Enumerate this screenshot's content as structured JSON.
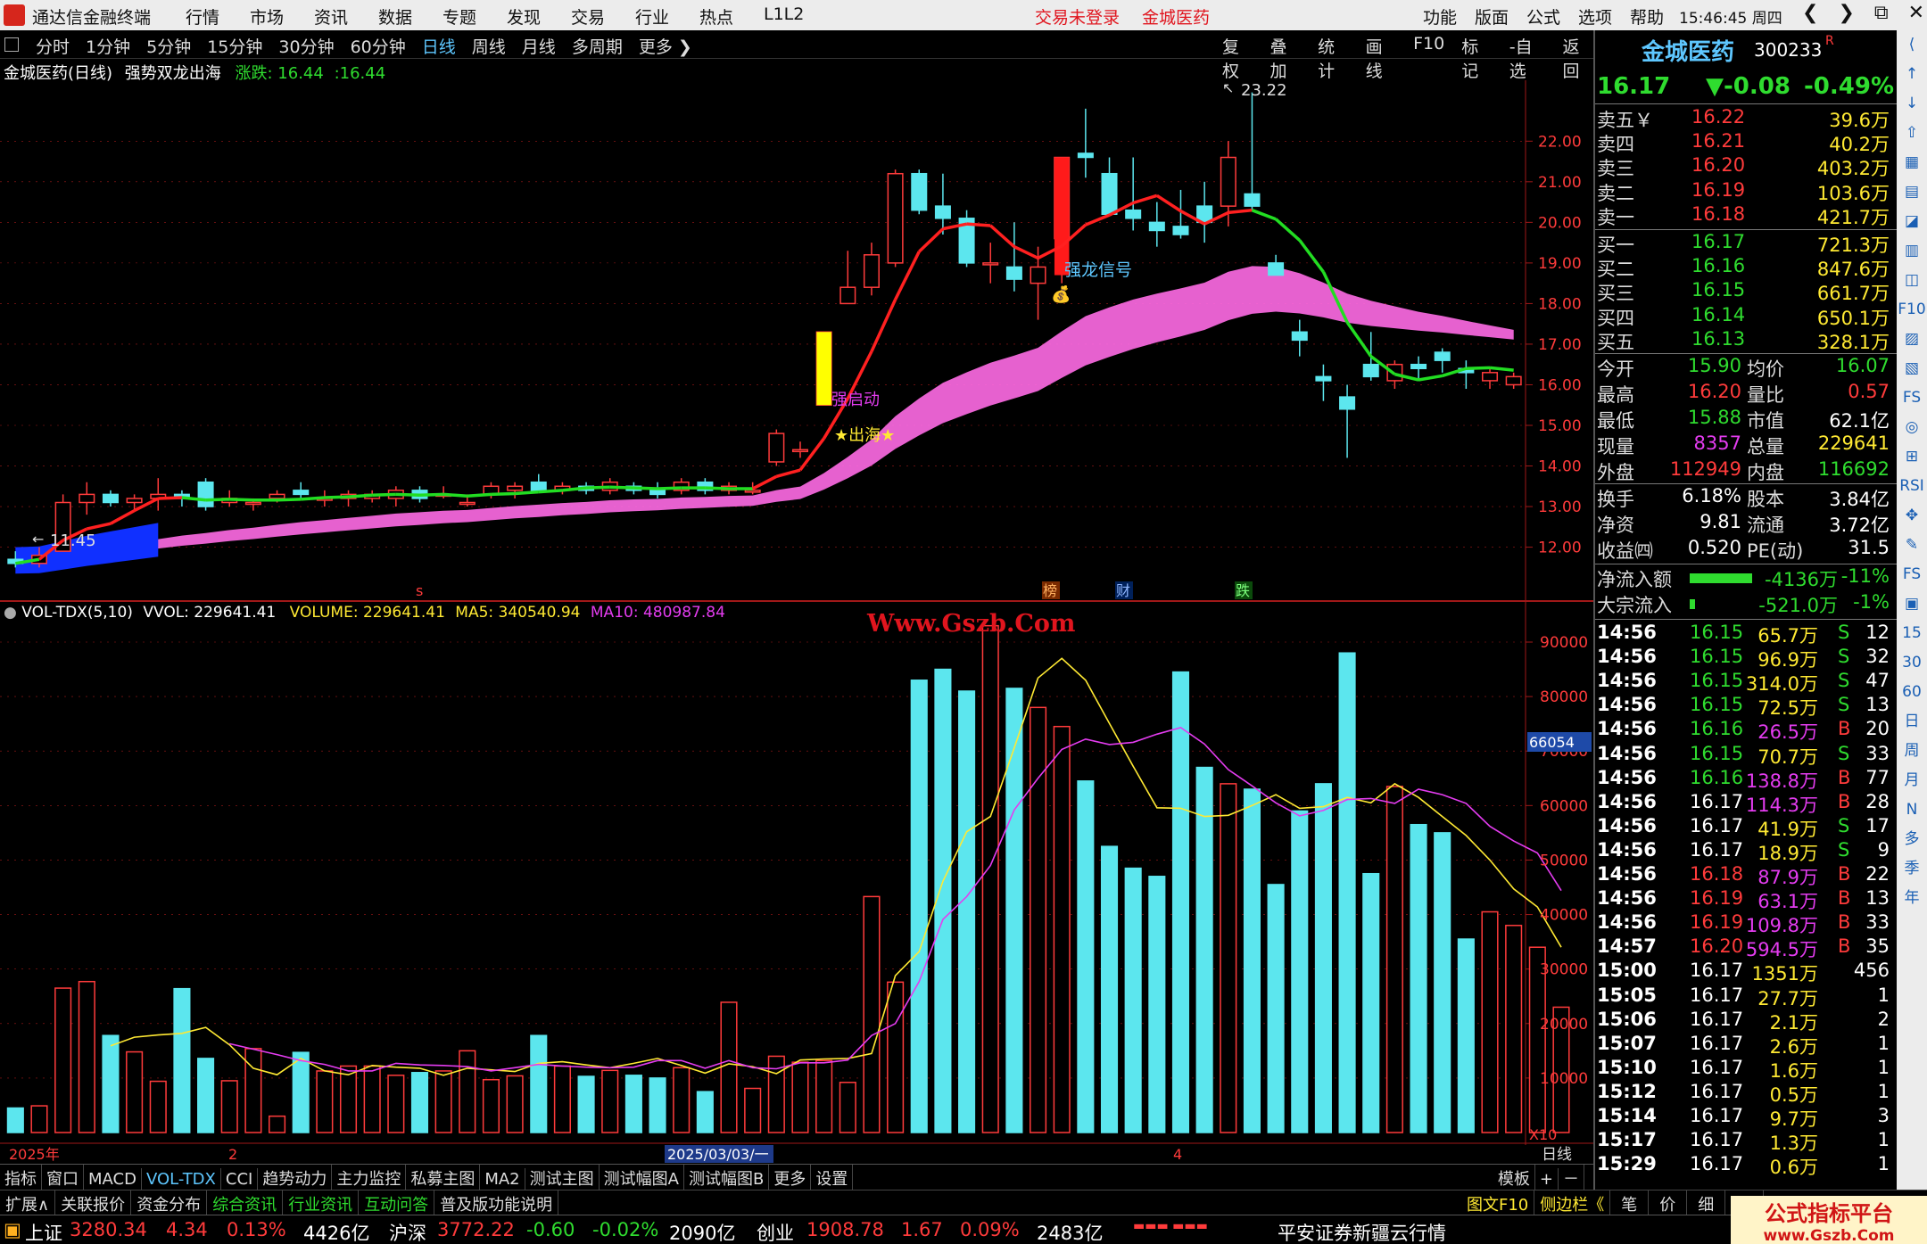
{
  "app": {
    "name": "通达信金融终端",
    "menu": [
      "行情",
      "市场",
      "资讯",
      "数据",
      "专题",
      "发现",
      "交易",
      "行业",
      "热点",
      "L1L2"
    ],
    "notice_login": "交易未登录",
    "notice_stock": "金城医药",
    "right_menu": [
      "功能",
      "版面",
      "公式",
      "选项",
      "帮助"
    ],
    "clock": "15:46:45",
    "weekday": "周四",
    "win_btns": [
      "❮",
      "❯",
      "⧉",
      "✕"
    ]
  },
  "periods": {
    "items": [
      "分时",
      "1分钟",
      "5分钟",
      "15分钟",
      "30分钟",
      "60分钟",
      "日线",
      "周线",
      "月线",
      "多周期",
      "更多 ❯"
    ],
    "active_index": 6,
    "tools": [
      "复权",
      "叠加",
      "统计",
      "画线",
      "F10",
      "标记",
      "-自选",
      "返回"
    ]
  },
  "chart_header": {
    "stock": "金城医药(日线)",
    "formula": "强势双龙出海",
    "change_label": "涨跌: 16.44",
    "change_value": ":16.44"
  },
  "chart_annotations": {
    "high_label": "23.22",
    "low_label": "11.45",
    "signal_dragon": "强龙信号",
    "signal_start": "强启动",
    "signal_sea": "★出海★",
    "marker_s": "s",
    "marker_bang": "榜",
    "marker_cai": "财",
    "marker_die": "跌",
    "y_ticks": [
      "22.00",
      "21.00",
      "20.00",
      "19.00",
      "18.00",
      "17.00",
      "16.00",
      "15.00",
      "14.00",
      "13.00",
      "12.00"
    ]
  },
  "volume_header": {
    "name": "VOL-TDX(5,10)",
    "vvol": "VVOL: 229641.41",
    "volume": "VOLUME: 229641.41",
    "ma5": "MA5: 340540.94",
    "ma10": "MA10: 480987.84",
    "y_ticks": [
      "90000",
      "80000",
      "70000",
      "60000",
      "50000",
      "40000",
      "30000",
      "20000",
      "10000"
    ],
    "cursor_value": "66054",
    "unit": "X10"
  },
  "watermark": "Www.Gszb.Com",
  "x_axis": {
    "labels": [
      "2025年",
      "2",
      "2025/03/03/一",
      "4"
    ],
    "period": "日线"
  },
  "bottom_tabs": {
    "items": [
      "指标",
      "窗口",
      "MACD",
      "VOL-TDX",
      "CCI",
      "趋势动力",
      "主力监控",
      "私募主图",
      "MA2",
      "测试主图",
      "测试幅图A",
      "测试幅图B",
      "更多",
      "设置"
    ],
    "active_index": 3,
    "right": [
      "模板",
      "+",
      "－"
    ]
  },
  "ext_bar": {
    "items": [
      "扩展∧",
      "关联报价",
      "资金分布",
      "综合资讯",
      "行业资讯",
      "互动问答",
      "普及版功能说明"
    ],
    "right": [
      "图文F10",
      "侧边栏《",
      "笔",
      "价",
      "细",
      "势"
    ]
  },
  "status": {
    "sh_label": "上证",
    "sh_value": "3280.34",
    "sh_change": "4.34",
    "sh_pct": "0.13%",
    "sh_amount": "4426亿",
    "hs_label": "沪深",
    "hs_value": "3772.22",
    "hs_change": "-0.60",
    "hs_pct": "-0.02%",
    "hs_amount": "2090亿",
    "cy_label": "创业",
    "cy_value": "1908.78",
    "cy_change": "1.67",
    "cy_pct": "0.09%",
    "cy_amount": "2483亿",
    "broker": "平安证券新疆云行情",
    "brand": "公式指标平台",
    "brand_url": "www.Gszb.Com"
  },
  "quote": {
    "name": "金城医药",
    "code": "300233",
    "flag": "R",
    "price": "16.17",
    "change": "▼-0.08",
    "pct": "-0.49%",
    "asks": [
      {
        "label": "卖五￥",
        "price": "16.22",
        "vol": "39.6万"
      },
      {
        "label": "卖四",
        "price": "16.21",
        "vol": "40.2万"
      },
      {
        "label": "卖三",
        "price": "16.20",
        "vol": "403.2万"
      },
      {
        "label": "卖二",
        "price": "16.19",
        "vol": "103.6万"
      },
      {
        "label": "卖一",
        "price": "16.18",
        "vol": "421.7万"
      }
    ],
    "bids": [
      {
        "label": "买一",
        "price": "16.17",
        "vol": "721.3万"
      },
      {
        "label": "买二",
        "price": "16.16",
        "vol": "847.6万"
      },
      {
        "label": "买三",
        "price": "16.15",
        "vol": "661.7万"
      },
      {
        "label": "买四",
        "price": "16.14",
        "vol": "650.1万"
      },
      {
        "label": "买五",
        "price": "16.13",
        "vol": "328.1万"
      }
    ],
    "stats": [
      {
        "l1": "今开",
        "v1": "15.90",
        "l2": "均价",
        "v2": "16.07"
      },
      {
        "l1": "最高",
        "v1": "16.20",
        "l2": "量比",
        "v2": "0.57"
      },
      {
        "l1": "最低",
        "v1": "15.88",
        "l2": "市值",
        "v2": "62.1亿"
      },
      {
        "l1": "现量",
        "v1": "8357",
        "l2": "总量",
        "v2": "229641"
      },
      {
        "l1": "外盘",
        "v1": "112949",
        "l2": "内盘",
        "v2": "116692"
      }
    ],
    "fund": [
      {
        "l1": "换手",
        "v1": "6.18%",
        "l2": "股本",
        "v2": "3.84亿"
      },
      {
        "l1": "净资",
        "v1": "9.81",
        "l2": "流通",
        "v2": "3.72亿"
      },
      {
        "l1": "收益㈣",
        "v1": "0.520",
        "l2": "PE(动)",
        "v2": "31.5"
      }
    ],
    "flows": [
      {
        "label": "净流入额",
        "value": "-4136万",
        "pct": "-11%",
        "bar": 0.7
      },
      {
        "label": "大宗流入",
        "value": "-521.0万",
        "pct": "-1%",
        "bar": 0.03
      }
    ],
    "ticks": [
      {
        "t": "14:56",
        "p": "16.15",
        "v": "65.7万",
        "s": "S",
        "n": "12"
      },
      {
        "t": "14:56",
        "p": "16.15",
        "v": "96.9万",
        "s": "S",
        "n": "32"
      },
      {
        "t": "14:56",
        "p": "16.15",
        "v": "314.0万",
        "s": "S",
        "n": "47"
      },
      {
        "t": "14:56",
        "p": "16.15",
        "v": "72.5万",
        "s": "S",
        "n": "13"
      },
      {
        "t": "14:56",
        "p": "16.16",
        "v": "26.5万",
        "s": "B",
        "n": "20"
      },
      {
        "t": "14:56",
        "p": "16.15",
        "v": "70.7万",
        "s": "S",
        "n": "33"
      },
      {
        "t": "14:56",
        "p": "16.16",
        "v": "138.8万",
        "s": "B",
        "n": "77"
      },
      {
        "t": "14:56",
        "p": "16.17",
        "v": "114.3万",
        "s": "B",
        "n": "28"
      },
      {
        "t": "14:56",
        "p": "16.17",
        "v": "41.9万",
        "s": "S",
        "n": "17"
      },
      {
        "t": "14:56",
        "p": "16.17",
        "v": "18.9万",
        "s": "S",
        "n": "9"
      },
      {
        "t": "14:56",
        "p": "16.18",
        "v": "87.9万",
        "s": "B",
        "n": "22"
      },
      {
        "t": "14:56",
        "p": "16.19",
        "v": "63.1万",
        "s": "B",
        "n": "13"
      },
      {
        "t": "14:56",
        "p": "16.19",
        "v": "109.8万",
        "s": "B",
        "n": "33"
      },
      {
        "t": "14:57",
        "p": "16.20",
        "v": "594.5万",
        "s": "B",
        "n": "35"
      },
      {
        "t": "15:00",
        "p": "16.17",
        "v": "1351万",
        "s": "",
        "n": "456"
      },
      {
        "t": "15:05",
        "p": "16.17",
        "v": "27.7万",
        "s": "",
        "n": "1"
      },
      {
        "t": "15:06",
        "p": "16.17",
        "v": "2.1万",
        "s": "",
        "n": "2"
      },
      {
        "t": "15:07",
        "p": "16.17",
        "v": "2.6万",
        "s": "",
        "n": "1"
      },
      {
        "t": "15:10",
        "p": "16.17",
        "v": "1.6万",
        "s": "",
        "n": "1"
      },
      {
        "t": "15:12",
        "p": "16.17",
        "v": "0.5万",
        "s": "",
        "n": "1"
      },
      {
        "t": "15:14",
        "p": "16.17",
        "v": "9.7万",
        "s": "",
        "n": "3"
      },
      {
        "t": "15:17",
        "p": "16.17",
        "v": "1.3万",
        "s": "",
        "n": "1"
      },
      {
        "t": "15:29",
        "p": "16.17",
        "v": "0.6万",
        "s": "",
        "n": "1"
      }
    ]
  },
  "side_toolbar": [
    "⟨",
    "↑",
    "↓",
    "⇧",
    "▦",
    "▤",
    "◪",
    "▥",
    "◫",
    "F10",
    "▨",
    "▧",
    "FS",
    "◎",
    "⊞",
    "RSI",
    "✥",
    "✎",
    "FS",
    "▣",
    "15",
    "30",
    "60",
    "日",
    "周",
    "月",
    "N",
    "多",
    "季",
    "年"
  ],
  "colors": {
    "up": "#ff3b3b",
    "down": "#5ce6ee",
    "ma_red": "#ff2020",
    "ma_green": "#22dd22",
    "band": "#ff6be6",
    "ma5_vol": "#ffe933",
    "ma10_vol": "#e43cf0"
  },
  "chart_data": [
    {
      "type": "candlestick",
      "title": "金城医药(日线)",
      "y_range": [
        11.2,
        23.5
      ],
      "candles": [
        [
          11.7,
          11.9,
          11.5,
          11.6
        ],
        [
          11.6,
          12.0,
          11.5,
          11.8
        ],
        [
          11.9,
          13.3,
          11.9,
          13.1
        ],
        [
          13.1,
          13.6,
          12.8,
          13.3
        ],
        [
          13.3,
          13.4,
          13.0,
          13.1
        ],
        [
          13.1,
          13.3,
          12.9,
          13.2
        ],
        [
          13.2,
          13.7,
          12.9,
          13.3
        ],
        [
          13.3,
          13.4,
          13.0,
          13.2
        ],
        [
          13.6,
          13.7,
          12.9,
          13.0
        ],
        [
          13.1,
          13.4,
          13.0,
          13.2
        ],
        [
          13.1,
          13.2,
          12.9,
          13.1
        ],
        [
          13.2,
          13.4,
          13.1,
          13.3
        ],
        [
          13.4,
          13.6,
          13.2,
          13.3
        ],
        [
          13.2,
          13.4,
          13.0,
          13.2
        ],
        [
          13.2,
          13.4,
          13.0,
          13.3
        ],
        [
          13.2,
          13.4,
          13.1,
          13.3
        ],
        [
          13.2,
          13.5,
          13.0,
          13.4
        ],
        [
          13.4,
          13.5,
          13.1,
          13.2
        ],
        [
          13.3,
          13.5,
          13.2,
          13.3
        ],
        [
          13.1,
          13.3,
          13.0,
          13.1
        ],
        [
          13.3,
          13.6,
          13.2,
          13.5
        ],
        [
          13.4,
          13.6,
          13.2,
          13.5
        ],
        [
          13.6,
          13.8,
          13.4,
          13.4
        ],
        [
          13.4,
          13.6,
          13.3,
          13.5
        ],
        [
          13.5,
          13.6,
          13.3,
          13.4
        ],
        [
          13.4,
          13.7,
          13.3,
          13.6
        ],
        [
          13.5,
          13.6,
          13.3,
          13.4
        ],
        [
          13.4,
          13.6,
          13.2,
          13.3
        ],
        [
          13.4,
          13.7,
          13.3,
          13.6
        ],
        [
          13.6,
          13.7,
          13.3,
          13.4
        ],
        [
          13.4,
          13.6,
          13.3,
          13.5
        ],
        [
          13.4,
          13.6,
          13.3,
          13.4
        ],
        [
          14.1,
          14.9,
          14.0,
          14.8
        ],
        [
          14.4,
          14.6,
          14.2,
          14.4
        ],
        [
          15.5,
          17.3,
          15.5,
          17.3
        ],
        [
          18.0,
          19.3,
          18.0,
          18.4
        ],
        [
          18.4,
          19.5,
          18.2,
          19.2
        ],
        [
          19.0,
          21.3,
          18.9,
          21.2
        ],
        [
          21.2,
          21.3,
          20.2,
          20.3
        ],
        [
          20.4,
          21.2,
          19.7,
          20.1
        ],
        [
          20.1,
          20.3,
          18.9,
          19.0
        ],
        [
          19.0,
          19.5,
          18.5,
          19.0
        ],
        [
          18.9,
          20.0,
          18.3,
          18.6
        ],
        [
          18.5,
          19.4,
          17.6,
          18.9
        ],
        [
          19.6,
          21.6,
          18.5,
          21.6
        ],
        [
          21.7,
          22.8,
          21.1,
          21.6
        ],
        [
          21.2,
          21.6,
          20.2,
          20.2
        ],
        [
          20.3,
          21.6,
          19.8,
          20.1
        ],
        [
          20.0,
          20.5,
          19.4,
          19.8
        ],
        [
          19.9,
          20.8,
          19.6,
          19.7
        ],
        [
          20.4,
          21.0,
          19.5,
          20.0
        ],
        [
          20.4,
          22.0,
          19.9,
          21.6
        ],
        [
          20.7,
          23.2,
          20.3,
          20.4
        ],
        [
          19.0,
          19.2,
          18.7,
          18.7
        ],
        [
          17.3,
          17.6,
          16.7,
          17.1
        ],
        [
          16.2,
          16.5,
          15.6,
          16.1
        ],
        [
          15.7,
          16.0,
          14.2,
          15.4
        ],
        [
          16.5,
          17.3,
          16.1,
          16.2
        ],
        [
          16.1,
          16.6,
          15.9,
          16.5
        ],
        [
          16.5,
          16.7,
          16.1,
          16.4
        ],
        [
          16.8,
          16.9,
          16.3,
          16.6
        ],
        [
          16.4,
          16.6,
          15.9,
          16.3
        ],
        [
          16.1,
          16.4,
          15.9,
          16.3
        ],
        [
          16.0,
          16.3,
          15.9,
          16.2
        ]
      ]
    },
    {
      "type": "bar",
      "title": "VOL-TDX(5,10)",
      "y_range": [
        0,
        90000
      ],
      "values": [
        4500,
        4900,
        26500,
        27700,
        17800,
        14800,
        9400,
        26400,
        13600,
        9500,
        15400,
        3000,
        14700,
        11300,
        12200,
        12200,
        10500,
        11000,
        11300,
        15000,
        9700,
        10400,
        17800,
        12200,
        10300,
        11400,
        10500,
        10000,
        11900,
        7500,
        23900,
        8100,
        14000,
        12900,
        13200,
        9200,
        43300,
        27600,
        83000,
        85000,
        81000,
        93000,
        81500,
        78000,
        74500,
        64500,
        52500,
        48500,
        47000,
        84500,
        67000,
        64000,
        63000,
        45500,
        59000,
        64000,
        88000,
        47500,
        63500,
        56500,
        55000,
        35500,
        40500,
        38000,
        34000,
        23000
      ],
      "ma5": [
        null,
        null,
        null,
        null,
        15900,
        17500,
        17900,
        18200,
        19300,
        16100,
        11800,
        10600,
        13600,
        11300,
        10600,
        12300,
        12000,
        11800,
        10500,
        11800,
        11500,
        11200,
        12700,
        13000,
        12400,
        11900,
        12700,
        13600,
        12300,
        10900,
        12600,
        12100,
        10800,
        13300,
        13500,
        13600,
        14500,
        28800,
        33200,
        46100,
        55200,
        58000,
        70600,
        83400,
        87000,
        83000,
        75100,
        67200,
        59600,
        59500,
        58000,
        58200,
        60000,
        62000,
        59500,
        59800,
        61500,
        60500,
        64000,
        61500,
        58000,
        54500,
        50000,
        44700,
        41400,
        34000
      ],
      "ma10": [
        null,
        null,
        null,
        null,
        null,
        null,
        null,
        null,
        null,
        16300,
        15300,
        14300,
        13200,
        12500,
        11300,
        11300,
        12700,
        12400,
        12300,
        12100,
        11300,
        11900,
        12500,
        12200,
        12000,
        11900,
        12000,
        13200,
        13200,
        11800,
        13200,
        11900,
        11700,
        12800,
        12800,
        13300,
        17800,
        20000,
        27700,
        39100,
        43300,
        49000,
        59200,
        65000,
        70300,
        72200,
        71200,
        71600,
        73100,
        74300,
        71300,
        66600,
        63600,
        60500,
        58100,
        59100,
        61100,
        61300,
        60400,
        63000,
        62000,
        60400,
        56200,
        53500,
        51300,
        44400
      ]
    }
  ]
}
